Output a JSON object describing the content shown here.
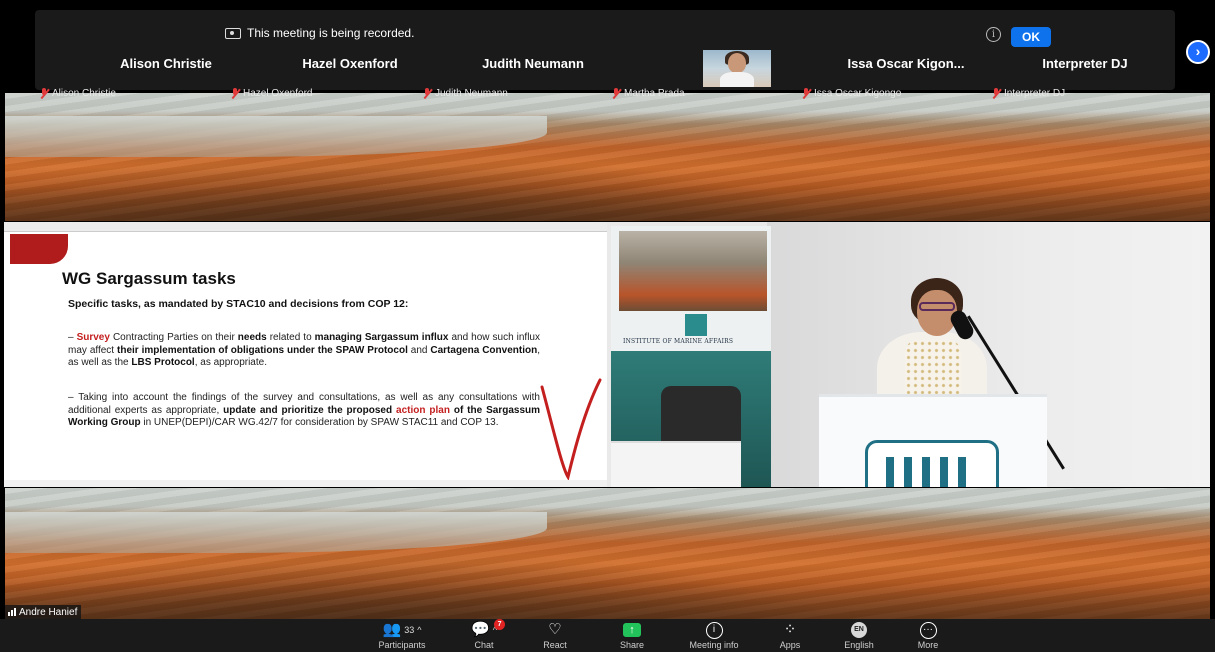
{
  "recording_banner": {
    "text": "This meeting is being recorded.",
    "ok_label": "OK"
  },
  "participants_strip": [
    {
      "name": "Alison Christie",
      "sub": "Alison Christie",
      "muted": true
    },
    {
      "name": "Hazel Oxenford",
      "sub": "Hazel Oxenford",
      "muted": true
    },
    {
      "name": "Judith Neumann",
      "sub": "Judith Neumann",
      "muted": true
    },
    {
      "name": "",
      "sub": "Martha Prada",
      "muted": true,
      "video": true
    },
    {
      "name": "Issa Oscar Kigon...",
      "sub": "Issa Oscar Kigongo",
      "muted": true
    },
    {
      "name": "Interpreter DJ",
      "sub": "Interpreter DJ",
      "muted": true
    }
  ],
  "slide": {
    "title": "WG Sargassum tasks",
    "subtitle": "Specific tasks, as mandated by STAC10 and decisions from COP 12:",
    "bullet1": {
      "dash": "–",
      "w1": "Survey",
      "t1": " Contracting Parties on their ",
      "w2": "needs",
      "t2": " related to ",
      "w3": "managing Sargassum influx",
      "t3": " and how such influx may affect ",
      "w4": "their implementation of obligations under the SPAW Protocol",
      "t4": " and ",
      "w5": "Cartagena Convention",
      "t5": ", as well as the ",
      "w6": "LBS Protocol",
      "t6": ", as appropriate."
    },
    "bullet2": {
      "dash": "–",
      "t1": "Taking into account the findings of the survey and consultations, as well as any consultations with additional experts as appropriate, ",
      "w1": "update and prioritize the proposed",
      "t2": " ",
      "w2": "action plan",
      "t3": " ",
      "w3": "of the Sargassum Working Group",
      "t4": " in UNEP(DEPI)/CAR WG.42/7 for consideration by SPAW STAC11 and COP 13."
    }
  },
  "speaker_banner_text": "INSTITUTE OF MARINE AFFAIRS",
  "active_speaker": "Andre Hanief",
  "toolbar": {
    "participants_label": "Participants",
    "participants_count": "33",
    "chat_label": "Chat",
    "chat_badge": "7",
    "react_label": "React",
    "share_label": "Share",
    "meeting_info_label": "Meeting info",
    "apps_label": "Apps",
    "language_label": "English",
    "language_badge": "EN",
    "more_label": "More"
  },
  "colors": {
    "accent": "#0e72ed",
    "share_green": "#23c35b",
    "muted_red": "#e03a3a",
    "slide_red": "#b01b1b",
    "highlight_red": "#c41f1f"
  },
  "icons": [
    "recording-icon",
    "info-icon",
    "mic-muted-icon",
    "next-page-icon",
    "participants-icon",
    "chat-icon",
    "react-icon",
    "share-icon",
    "meeting-info-icon",
    "apps-icon",
    "language-icon",
    "more-icon",
    "signal-icon"
  ]
}
